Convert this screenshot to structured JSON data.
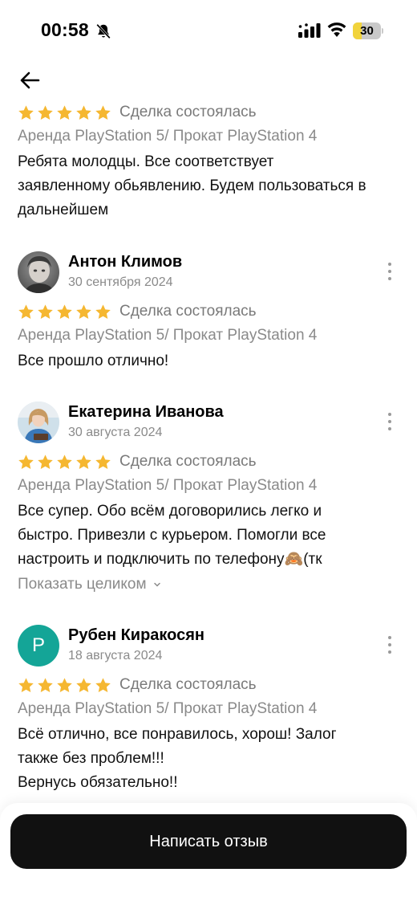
{
  "status_bar": {
    "time": "00:58",
    "battery_level": "30",
    "battery_fraction": 0.3
  },
  "colors": {
    "star": "#f5b731",
    "avatar_p": "#14a597",
    "button": "#111111",
    "battery": "#f1d33b"
  },
  "reviews": [
    {
      "rating": 5,
      "deal_status": "Сделка состоялась",
      "listing": "Аренда PlayStation 5/ Прокат PlayStation 4",
      "text": "Ребята молодцы. Все соответствует\nзаявленному обьявлению. Будем пользоваться в\nдальнейшем"
    },
    {
      "author": "Антон Климов",
      "date": "30 сентября 2024",
      "avatar": "photo-man-icon",
      "rating": 5,
      "deal_status": "Сделка состоялась",
      "listing": "Аренда PlayStation 5/ Прокат PlayStation 4",
      "text": "Все прошло отлично!"
    },
    {
      "author": "Екатерина Иванова",
      "date": "30 августа 2024",
      "avatar": "photo-woman-icon",
      "rating": 5,
      "deal_status": "Сделка состоялась",
      "listing": "Аренда PlayStation 5/ Прокат PlayStation 4",
      "text": "Все супер. Обо всём договорились легко и\nбыстро. Привезли с курьером. Помогли все\nнастроить и подключить по телефону🙈(тк",
      "show_more": "Показать целиком"
    },
    {
      "author": "Рубен Киракосян",
      "date": "18 августа 2024",
      "avatar_letter": "Р",
      "rating": 5,
      "deal_status": "Сделка состоялась",
      "listing": "Аренда PlayStation 5/ Прокат PlayStation 4",
      "text": "Всё отлично,  все понравилось,  хорош! Залог\nтакже без проблем!!!\nВернусь обязательно!!"
    }
  ],
  "bottom": {
    "write_review_label": "Написать отзыв"
  }
}
